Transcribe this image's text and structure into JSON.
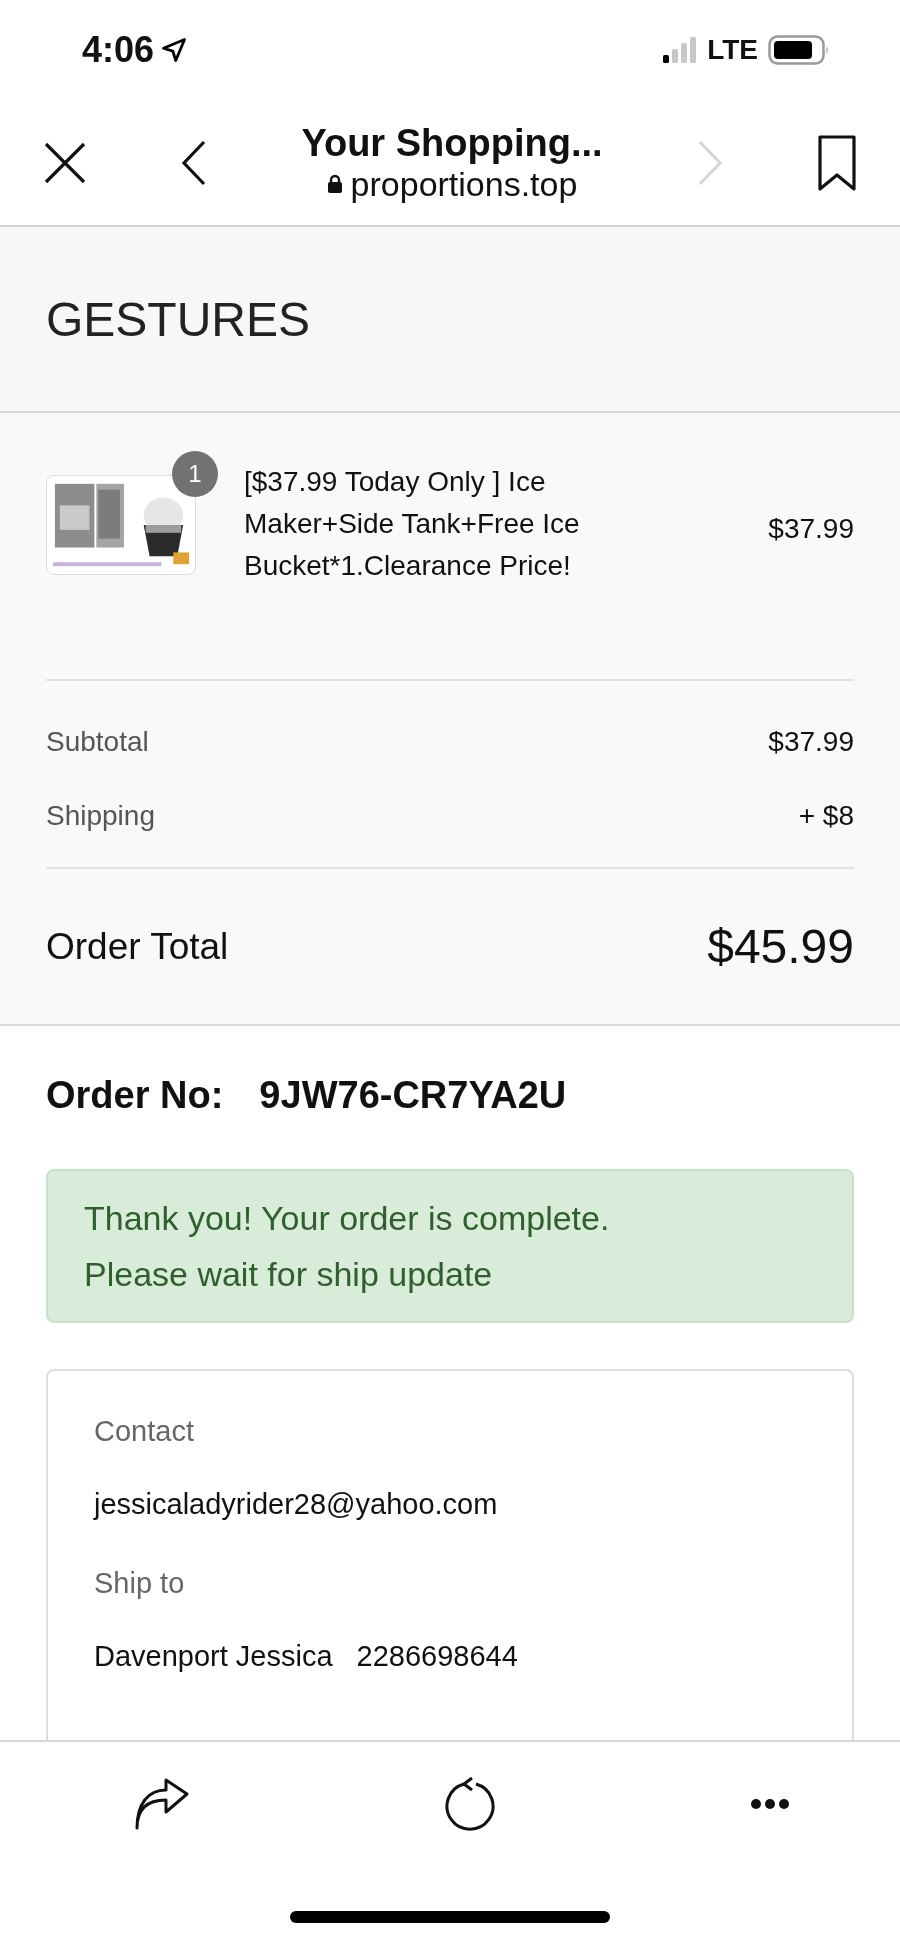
{
  "status_bar": {
    "time": "4:06",
    "network": "LTE"
  },
  "browser_bar": {
    "title": "Your Shopping...",
    "url": "proportions.top",
    "forward_disabled": true
  },
  "store": {
    "name": "GESTURES"
  },
  "cart": {
    "items": [
      {
        "quantity": "1",
        "title": "[$37.99 Today Only ] Ice Maker+Side Tank+Free Ice Bucket*1.Clearance Price!",
        "price": "$37.99"
      }
    ],
    "subtotal_label": "Subtotal",
    "subtotal": "$37.99",
    "shipping_label": "Shipping",
    "shipping": "+ $8",
    "total_label": "Order Total",
    "total": "$45.99"
  },
  "order": {
    "label": "Order No:",
    "number": "9JW76-CR7YA2U"
  },
  "notice": {
    "lines": [
      "Thank you! Your order is complete.",
      "Please wait for ship update"
    ]
  },
  "details": {
    "contact_label": "Contact",
    "contact": "jessicaladyrider28@yahoo.com",
    "ship_label": "Ship to",
    "ship_name": "Davenport Jessica",
    "ship_phone": "2286698644"
  }
}
